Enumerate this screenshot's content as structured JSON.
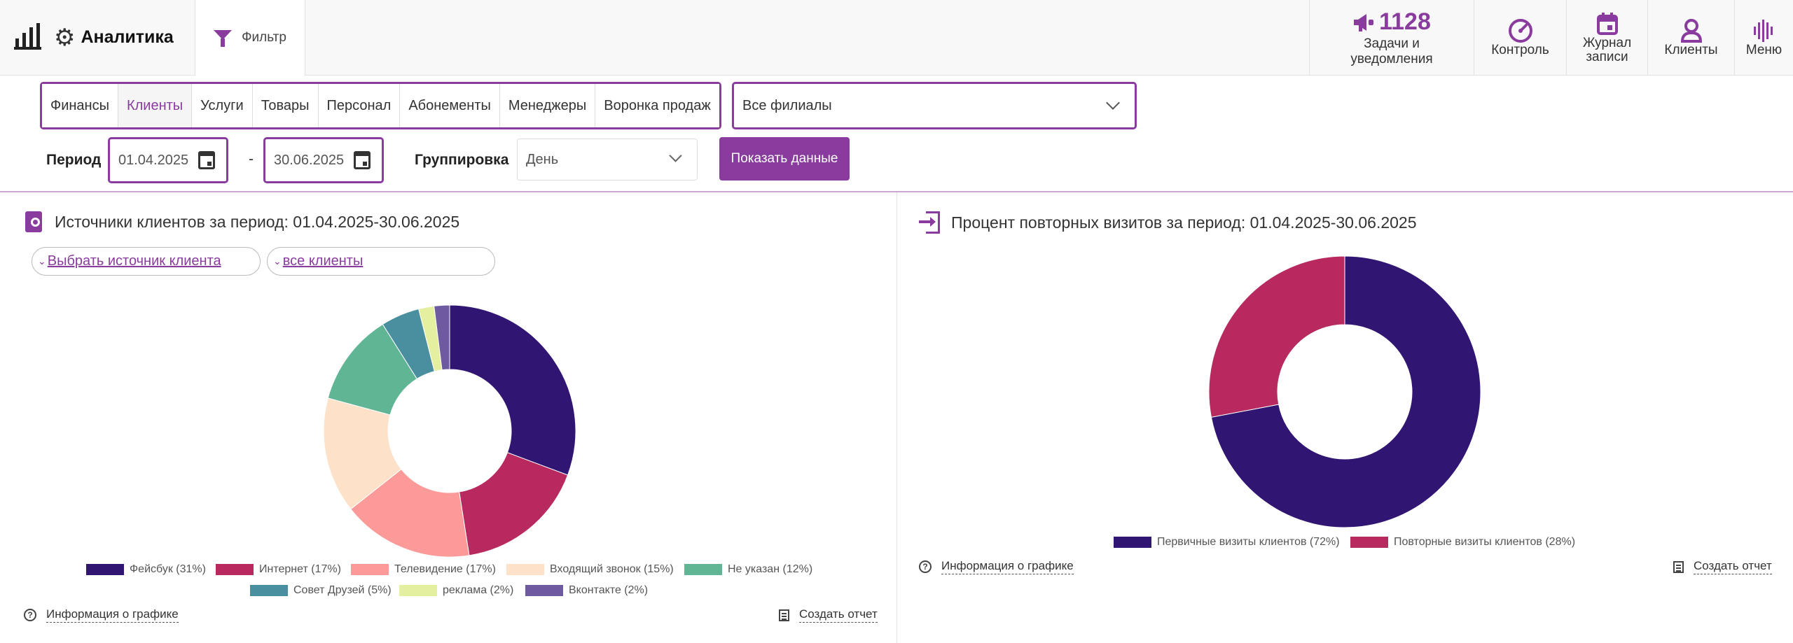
{
  "header": {
    "app_title": "Аналитика",
    "filter_label": "Фильтр",
    "tasks": {
      "count": "1128",
      "label_line1": "Задачи и",
      "label_line2": "уведомления"
    },
    "nav": [
      {
        "label_line1": "Контроль",
        "label_line2": ""
      },
      {
        "label_line1": "Журнал",
        "label_line2": "записи"
      },
      {
        "label_line1": "Клиенты",
        "label_line2": ""
      },
      {
        "label_line1": "Меню",
        "label_line2": ""
      }
    ]
  },
  "categories": [
    {
      "label": "Финансы",
      "active": false
    },
    {
      "label": "Клиенты",
      "active": true
    },
    {
      "label": "Услуги",
      "active": false
    },
    {
      "label": "Товары",
      "active": false
    },
    {
      "label": "Персонал",
      "active": false
    },
    {
      "label": "Абонементы",
      "active": false
    },
    {
      "label": "Менеджеры",
      "active": false
    },
    {
      "label": "Воронка продаж",
      "active": false
    }
  ],
  "branch_select": {
    "value": "Все филиалы"
  },
  "period": {
    "label": "Период",
    "from": "01.04.2025",
    "separator": "-",
    "to": "30.06.2025"
  },
  "grouping": {
    "label": "Группировка",
    "value": "День"
  },
  "show_button": "Показать данные",
  "left_panel": {
    "title": "Источники клиентов за период: 01.04.2025-30.06.2025",
    "source_filter": "Выбрать источник клиента",
    "client_filter": "все клиенты",
    "info_link": "Информация о графике",
    "report_link": "Создать отчет"
  },
  "right_panel": {
    "title": "Процент повторных визитов за период: 01.04.2025-30.06.2025",
    "info_link": "Информация о графике",
    "report_link": "Создать отчет"
  },
  "chart_data": [
    {
      "type": "pie",
      "variant": "donut",
      "legend_position": "bottom",
      "categories": [
        "Фейсбук (31%)",
        "Интернет (17%)",
        "Телевидение (17%)",
        "Входящий звонок (15%)",
        "Не указан (12%)",
        "Совет Друзей (5%)",
        "реклама (2%)",
        "Вконтакте (2%)"
      ],
      "values": [
        31,
        17,
        17,
        15,
        12,
        5,
        2,
        2
      ],
      "colors": [
        "#311573",
        "#b8295f",
        "#fb9a99",
        "#fde2c9",
        "#5fb594",
        "#4a8fa0",
        "#e4efa0",
        "#6e5b9f"
      ]
    },
    {
      "type": "pie",
      "variant": "donut",
      "legend_position": "bottom",
      "categories": [
        "Первичные визиты клиентов (72%)",
        "Повторные визиты клиентов (28%)"
      ],
      "values": [
        72,
        28
      ],
      "colors": [
        "#311573",
        "#b8295f"
      ]
    }
  ],
  "colors": {
    "accent": "#8a3c9e"
  }
}
